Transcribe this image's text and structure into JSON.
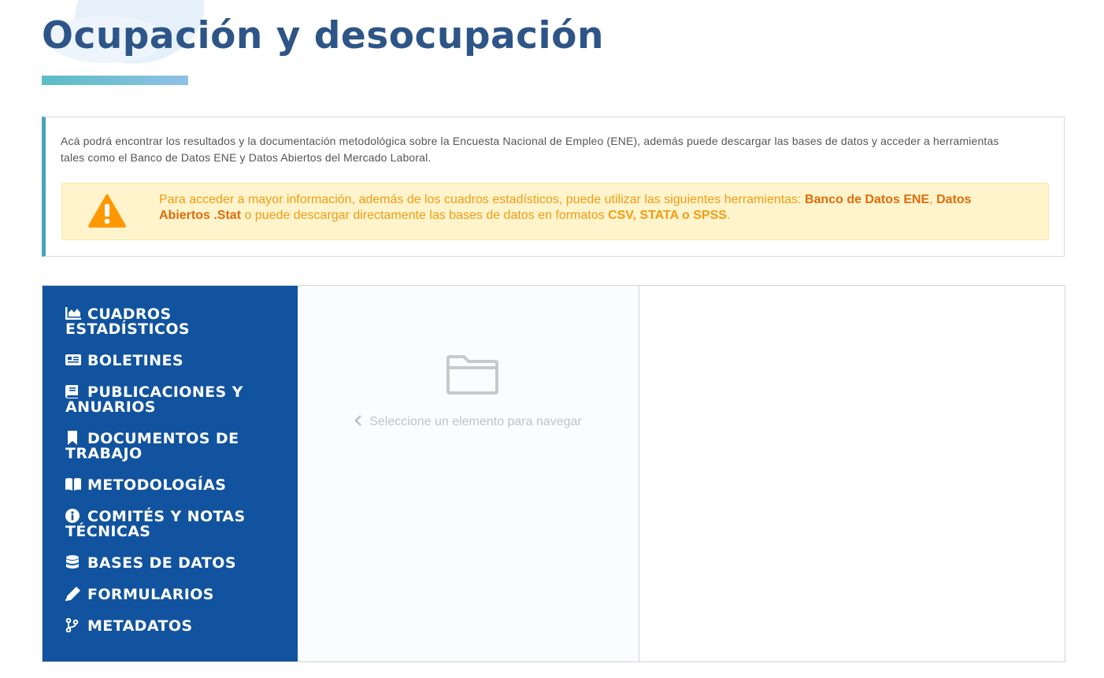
{
  "header": {
    "title": "Ocupación y desocupación",
    "accent_colors": [
      "#5bbcc4",
      "#8fc1e6"
    ],
    "title_color": "#2d5587"
  },
  "intro": {
    "text": "Acá podrá encontrar los resultados y la documentación metodológica sobre la Encuesta Nacional de Empleo (ENE), además puede descargar las bases de datos y acceder a herramientas tales como el Banco de Datos ENE y Datos Abiertos del Mercado Laboral."
  },
  "alert": {
    "icon": "warning-triangle-icon",
    "text_1": "Para acceder a mayor información, además de los cuadros estadísticos, puede utilizar las siguientes herramientas: ",
    "link_banco": "Banco de Datos ENE",
    "sep": ", ",
    "link_datos": "Datos Abiertos .Stat",
    "text_2": " o puede descargar directamente las bases de datos en formatos ",
    "formats": "CSV, STATA o SPSS",
    "text_3": ".",
    "color": "#f39c12",
    "background": "#fff4cc"
  },
  "sidebar": {
    "background": "#11539e",
    "items": [
      {
        "label": "CUADROS ESTADÍSTICOS",
        "icon": "area-chart-icon"
      },
      {
        "label": "BOLETINES",
        "icon": "newspaper-icon"
      },
      {
        "label": "PUBLICACIONES Y ANUARIOS",
        "icon": "book-icon"
      },
      {
        "label": "DOCUMENTOS DE TRABAJO",
        "icon": "bookmark-icon"
      },
      {
        "label": "METODOLOGÍAS",
        "icon": "open-book-icon"
      },
      {
        "label": "COMITÉS Y NOTAS TÉCNICAS",
        "icon": "info-circle-icon"
      },
      {
        "label": "BASES DE DATOS",
        "icon": "database-icon"
      },
      {
        "label": "FORMULARIOS",
        "icon": "pen-icon"
      },
      {
        "label": "METADATOS",
        "icon": "code-branch-icon"
      }
    ]
  },
  "browser": {
    "empty_icon": "folder-icon",
    "hint_icon": "chevron-left-icon",
    "hint": "Seleccione un elemento para navegar"
  }
}
